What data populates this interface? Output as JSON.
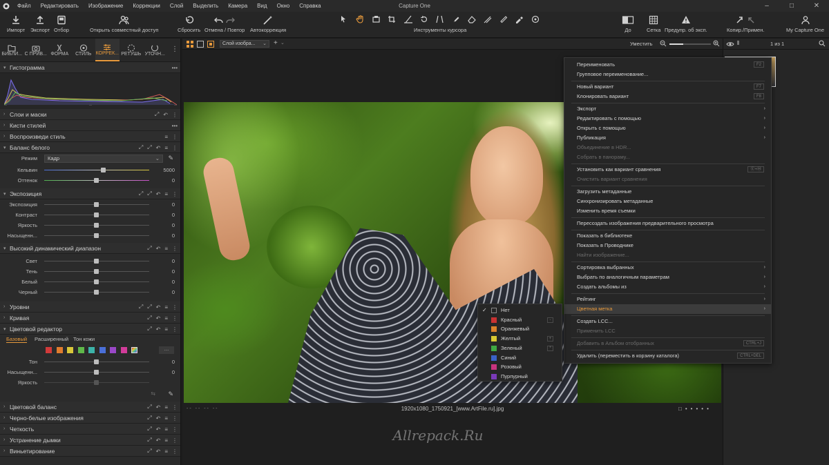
{
  "menubar": {
    "items": [
      "Файл",
      "Редактировать",
      "Изображение",
      "Коррекции",
      "Слой",
      "Выделить",
      "Камера",
      "Вид",
      "Окно",
      "Справка"
    ],
    "title": "Capture One"
  },
  "toolbar": {
    "import": "Импорт",
    "export": "Экспорт",
    "select": "Отбор",
    "share": "Открыть совместный доступ",
    "reset": "Сбросить",
    "undo_redo": "Отмена / Повтор",
    "auto": "Автокоррекция",
    "cursor_tools": "Инструменты курсора",
    "before": "До",
    "grid": "Сетка",
    "exposure_warning": "Предупр. об эксп.",
    "copy_apply": "Копир./Примен.",
    "account": "My Capture One"
  },
  "tool_tabs": [
    {
      "label": "БИБЛИ..."
    },
    {
      "label": "С ПРИВ..."
    },
    {
      "label": "ФОРМА"
    },
    {
      "label": "СТИЛЬ"
    },
    {
      "label": "КОРРЕК...",
      "active": true
    },
    {
      "label": "РЕТУШЬ"
    },
    {
      "label": "УТОЧН..."
    }
  ],
  "panel": {
    "histogram": "Гистограмма",
    "histogram_ticks": [
      "--",
      "--",
      "--"
    ],
    "layers": "Слои и маски",
    "style_brushes": "Кисти стилей",
    "replay_style": "Воспроизведи стиль",
    "white_balance": {
      "title": "Баланс белого",
      "mode_label": "Режим",
      "mode_value": "Кадр",
      "kelvin_label": "Кельвин",
      "kelvin_value": "5000",
      "tint_label": "Оттенок",
      "tint_value": "0"
    },
    "exposure": {
      "title": "Экспозиция",
      "rows": [
        {
          "label": "Экспозиция",
          "value": "0"
        },
        {
          "label": "Контраст",
          "value": "0"
        },
        {
          "label": "Яркость",
          "value": "0"
        },
        {
          "label": "Насыщенн...",
          "value": "0"
        }
      ]
    },
    "hdr": {
      "title": "Высокий динамический диапазон",
      "rows": [
        {
          "label": "Свет",
          "value": "0"
        },
        {
          "label": "Тень",
          "value": "0"
        },
        {
          "label": "Белый",
          "value": "0"
        },
        {
          "label": "Черный",
          "value": "0"
        }
      ]
    },
    "levels": "Уровни",
    "curve": "Кривая",
    "color_editor": {
      "title": "Цветовой редактор",
      "tabs": [
        "Базовый",
        "Расширенный",
        "Тон кожи"
      ],
      "swatches": [
        "#d23a3a",
        "#e07c2e",
        "#d9c73a",
        "#5fb84a",
        "#3cb3a8",
        "#4a6fd8",
        "#9a48c8",
        "#d23c9a"
      ],
      "rows": [
        {
          "label": "Тон",
          "value": "0"
        },
        {
          "label": "Насыщенн...",
          "value": "0"
        },
        {
          "label": "Яркость",
          "value": ""
        }
      ]
    },
    "color_balance": "Цветовой баланс",
    "bw": "Черно-белые изображения",
    "clarity": "Четкость",
    "dehaze": "Устранение дымки",
    "vignetting": "Виньетирование"
  },
  "viewer": {
    "preset": "Слой изобра...",
    "fit": "Уместить",
    "page_count": "1 из 1",
    "filename": "1920x1080_1750921_[www.ArtFile.ru].jpg",
    "meta_dashes": "--  --  --  --",
    "watermark": "Allrepack.Ru"
  },
  "context_menu": [
    {
      "label": "Переименовать",
      "shortcut": "F2"
    },
    {
      "label": "Групповое переименование..."
    },
    {
      "sep": true
    },
    {
      "label": "Новый вариант",
      "shortcut": "F7"
    },
    {
      "label": "Клонировать вариант",
      "shortcut": "F8"
    },
    {
      "sep": true
    },
    {
      "label": "Экспорт",
      "submenu": true
    },
    {
      "label": "Редактировать с помощью",
      "submenu": true
    },
    {
      "label": "Открыть с помощью",
      "submenu": true
    },
    {
      "label": "Публикация",
      "submenu": true
    },
    {
      "label": "Объединение в HDR...",
      "disabled": true
    },
    {
      "label": "Собрать в панораму...",
      "disabled": true
    },
    {
      "sep": true
    },
    {
      "label": "Установить как вариант сравнения",
      "shortcut": "Ⓔ+Ⓜ"
    },
    {
      "label": "Очистить вариант сравнения",
      "disabled": true
    },
    {
      "sep": true
    },
    {
      "label": "Загрузить метаданные"
    },
    {
      "label": "Синхронизировать метаданные"
    },
    {
      "label": "Изменить время съемки"
    },
    {
      "sep": true
    },
    {
      "label": "Пересоздать изображения предварительного просмотра"
    },
    {
      "sep": true
    },
    {
      "label": "Показать в библиотеке"
    },
    {
      "label": "Показать в Проводнике"
    },
    {
      "label": "Найти изображение...",
      "disabled": true
    },
    {
      "sep": true
    },
    {
      "label": "Сортировка выбранных",
      "submenu": true
    },
    {
      "label": "Выбрать по аналогичным параметрам",
      "submenu": true
    },
    {
      "label": "Создать альбомы из",
      "submenu": true
    },
    {
      "sep": true
    },
    {
      "label": "Рейтинг",
      "submenu": true
    },
    {
      "label": "Цветная метка",
      "submenu": true,
      "highlighted": true
    },
    {
      "sep": true
    },
    {
      "label": "Создать LCC..."
    },
    {
      "label": "Применить LCC",
      "disabled": true
    },
    {
      "sep": true
    },
    {
      "label": "Добавить в Альбом отобранных",
      "shortcut": "CTRL+J",
      "disabled": true
    },
    {
      "sep": true
    },
    {
      "label": "Удалить (переместить в корзину каталога)",
      "shortcut": "CTRL+DEL"
    }
  ],
  "color_tag_menu": [
    {
      "label": "Нет",
      "color": "none",
      "checked": true
    },
    {
      "label": "Красный",
      "color": "#c83232",
      "shortcut": "-"
    },
    {
      "label": "Оранжевый",
      "color": "#d9822b"
    },
    {
      "label": "Желтый",
      "color": "#d8c832",
      "shortcut": "+"
    },
    {
      "label": "Зеленый",
      "color": "#3fa843",
      "shortcut": "*"
    },
    {
      "label": "Синий",
      "color": "#3a62c8"
    },
    {
      "label": "Розовый",
      "color": "#c8347e"
    },
    {
      "label": "Пурпурный",
      "color": "#7a3ab8"
    }
  ]
}
